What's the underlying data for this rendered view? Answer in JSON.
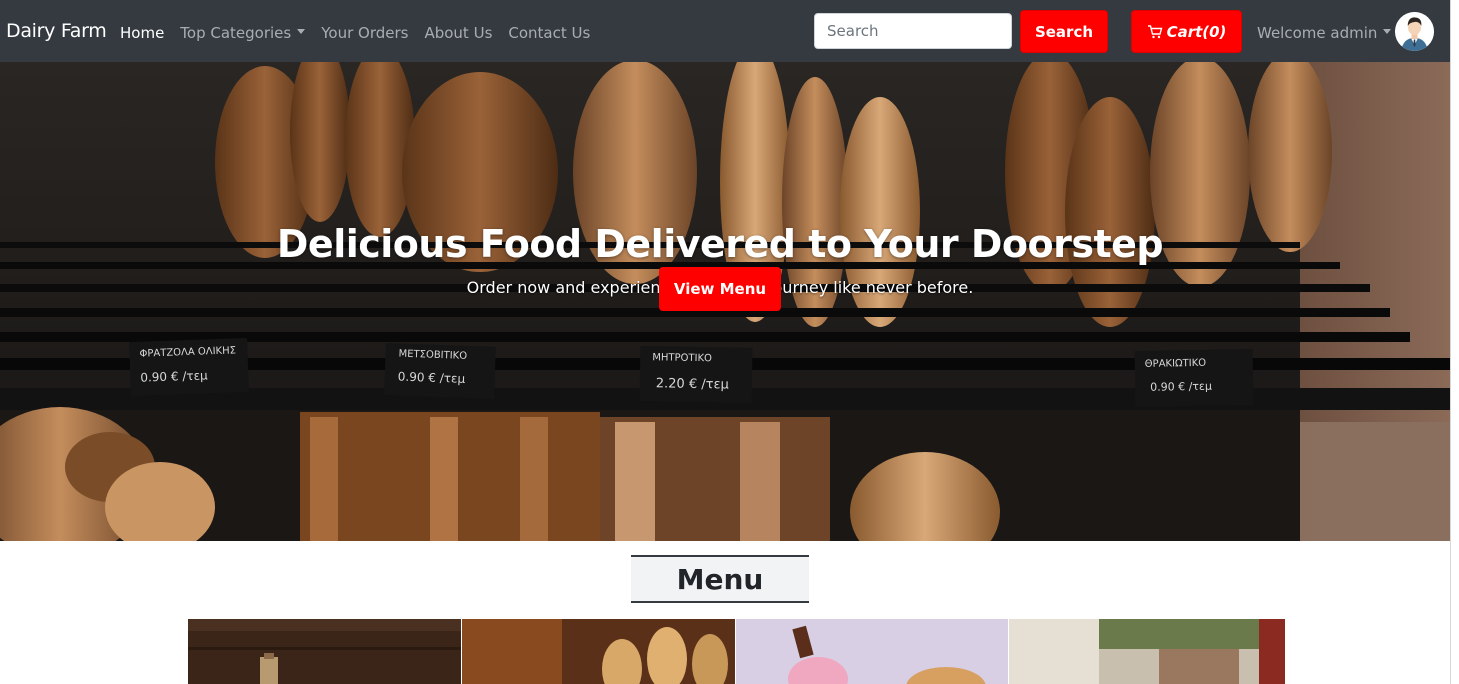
{
  "navbar": {
    "brand": "Dairy Farm",
    "links": {
      "home": "Home",
      "top_categories": "Top Categories",
      "your_orders": "Your Orders",
      "about_us": "About Us",
      "contact_us": "Contact Us"
    },
    "search_placeholder": "Search",
    "search_button": "Search",
    "cart_button": "Cart(0)",
    "welcome": "Welcome admin"
  },
  "hero": {
    "title": "Delicious Food Delivered to Your Doorstep",
    "subtitle": "Order now and experience a culinary journey like never before.",
    "cta": "View Menu",
    "price_tags": [
      {
        "name": "ΦΡΑΤΖΟΛΑ ΟΛΙΚΗΣ",
        "price": "0.90 € /τεμ"
      },
      {
        "name": "ΜΕΤΣΟΒΙΤΙΚΟ",
        "price": "0.90 € /τεμ"
      },
      {
        "name": "ΜΗΤΡΟΤΙΚΟ",
        "price": "2.20 € /τεμ"
      },
      {
        "name": "ΘΡΑΚΙΩΤΙΚΟ",
        "price": "0.90 € /τεμ"
      }
    ]
  },
  "menu": {
    "heading": "Menu"
  },
  "colors": {
    "navbar_bg": "#343a40",
    "accent": "#ff0000",
    "nav_text": "#a9adb2"
  },
  "icons": [
    "caret-down-icon",
    "cart-icon",
    "user-avatar-icon"
  ]
}
